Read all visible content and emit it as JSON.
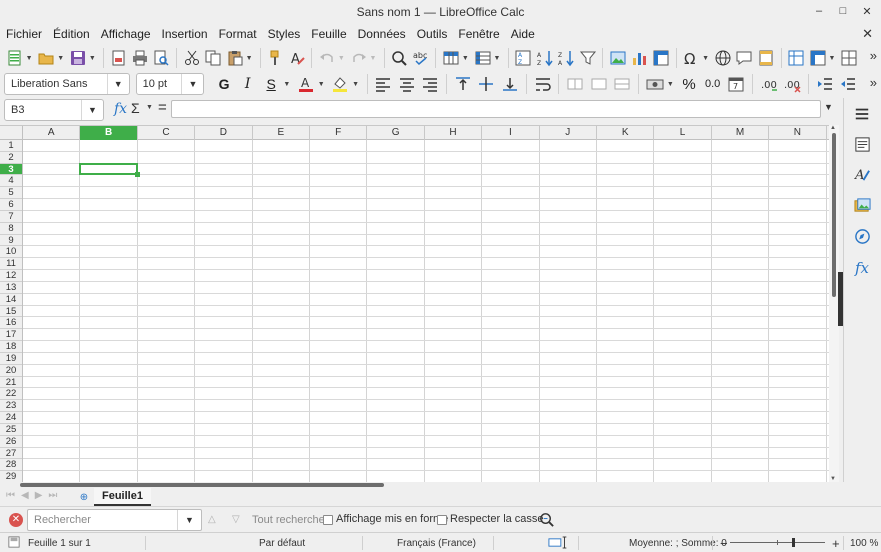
{
  "window": {
    "title": "Sans nom 1 — LibreOffice Calc",
    "minimize": "–",
    "maximize": "□",
    "close": "✕"
  },
  "menu": [
    "Fichier",
    "Édition",
    "Affichage",
    "Insertion",
    "Format",
    "Styles",
    "Feuille",
    "Données",
    "Outils",
    "Fenêtre",
    "Aide"
  ],
  "menu_close": "✕",
  "toolbar": {
    "font_name": "Liberation Sans",
    "font_size": "10 pt",
    "bold": "G",
    "italic": "I",
    "underline": "S",
    "percent": "%",
    "decimals": "0.0",
    "overflow": "»"
  },
  "formula_bar": {
    "name_box": "B3",
    "fx": "fx",
    "sigma": "Σ",
    "equals": "=",
    "formula": ""
  },
  "grid": {
    "columns": [
      "A",
      "B",
      "C",
      "D",
      "E",
      "F",
      "G",
      "H",
      "I",
      "J",
      "K",
      "L",
      "M",
      "N"
    ],
    "rows": [
      "1",
      "2",
      "3",
      "4",
      "5",
      "6",
      "7",
      "8",
      "9",
      "10",
      "11",
      "12",
      "13",
      "14",
      "15",
      "16",
      "17",
      "18",
      "19",
      "20",
      "21",
      "22",
      "23",
      "24",
      "25",
      "26",
      "27",
      "28",
      "29"
    ],
    "selected_column": "B",
    "selected_row": "3"
  },
  "sheets": {
    "tabs": [
      "Feuille1"
    ],
    "active": "Feuille1",
    "add": "⊕"
  },
  "find": {
    "placeholder": "Rechercher",
    "find_all": "Tout rechercher",
    "formatted_display": "Affichage mis en forme",
    "match_case": "Respecter la casse"
  },
  "status": {
    "sheet": "Feuille 1 sur 1",
    "style": "Par défaut",
    "language": "Français (France)",
    "summary": "Moyenne: ; Somme: 0",
    "zoom_minus": "−",
    "zoom_plus": "+",
    "zoom": "100 %"
  },
  "colors": {
    "selection": "#3fae49",
    "accent_blue": "#2a76c6"
  }
}
